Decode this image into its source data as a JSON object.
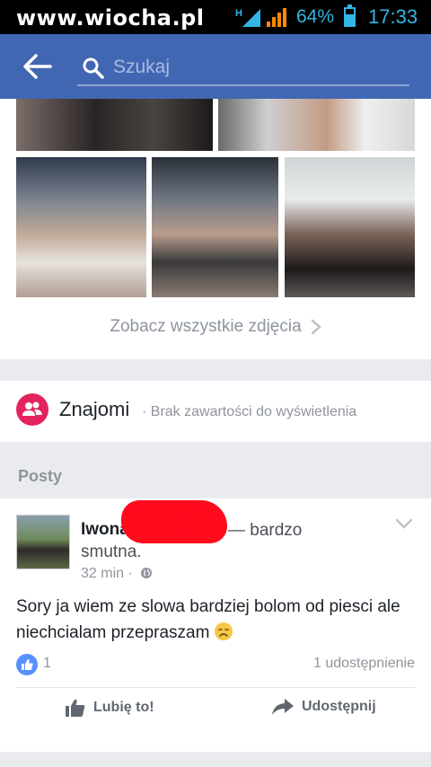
{
  "watermark": "www.wiocha.pl",
  "status": {
    "battery_pct": "64%",
    "battery_level": 0.64,
    "time": "17:33",
    "network_label": "H"
  },
  "header": {
    "search_placeholder": "Szukaj"
  },
  "photos": {
    "see_all": "Zobacz wszystkie zdjęcia"
  },
  "friends": {
    "title": "Znajomi",
    "subtitle": "· Brak zawartości do wyświetlenia"
  },
  "posts": {
    "header": "Posty",
    "item": {
      "author": "Iwona",
      "status_text": "— bardzo smutna.",
      "time": "32 min ·",
      "body": "Sory ja wiem ze slowa bardziej bolom od piesci ale niechcialam przepraszam",
      "likes": "1",
      "shares": "1 udostępnienie",
      "like_button": "Lubię to!",
      "share_button": "Udostępnij"
    }
  },
  "colors": {
    "brand": "#4267b2",
    "friends_icon": "#e4245d",
    "like_badge": "#5890ff",
    "status_accent": "#33b5e5"
  }
}
